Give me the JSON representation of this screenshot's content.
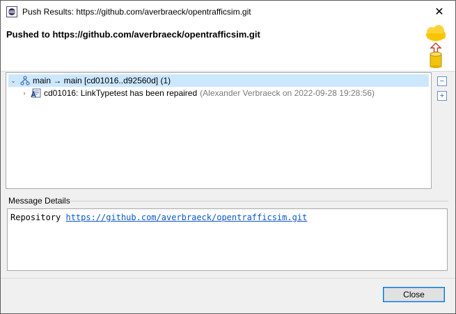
{
  "window": {
    "title": "Push Results: https://github.com/averbraeck/opentrafficsim.git",
    "close_glyph": "✕"
  },
  "header": {
    "title": "Pushed to https://github.com/averbraeck/opentrafficsim.git",
    "icon": "push-to-cloud-icon"
  },
  "tree": {
    "branch_row": {
      "expand_glyph": "⌄",
      "label": "main → main [cd01016..d92560d] (1)",
      "icon": "branch-icon"
    },
    "commit_row": {
      "expand_glyph": "›",
      "label": "cd01016: LinkTypetest has been repaired",
      "meta": "(Alexander Verbraeck on 2022-09-28 19:28:56)",
      "icon": "commit-icon"
    },
    "collapse_all_glyph": "−",
    "expand_all_glyph": "+"
  },
  "message_details": {
    "section_label": "Message Details",
    "prefix": "Repository",
    "link": "https://github.com/averbraeck/opentrafficsim.git"
  },
  "footer": {
    "close_label": "Close"
  },
  "colors": {
    "selection": "#cce8ff",
    "link": "#0b57c9",
    "button_border": "#0078d7"
  }
}
